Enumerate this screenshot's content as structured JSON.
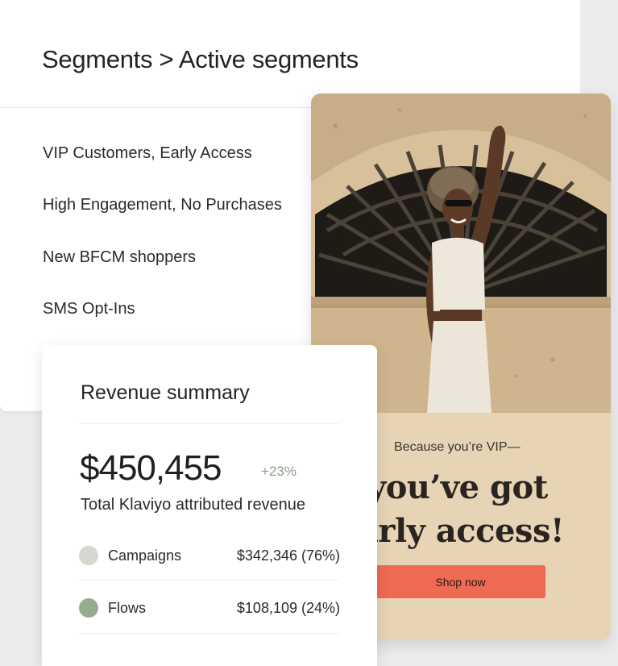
{
  "segments": {
    "breadcrumb": "Segments > Active segments",
    "items": [
      {
        "label": "VIP Customers, Early Access"
      },
      {
        "label": "High Engagement, No Purchases"
      },
      {
        "label": "New BFCM shoppers"
      },
      {
        "label": "SMS Opt-Ins"
      }
    ]
  },
  "email": {
    "kicker": "Because you’re VIP—",
    "headline_line1": "you’ve got",
    "headline_line2": "arly access!",
    "button_label": "Shop now",
    "colors": {
      "background": "#e6d4b5",
      "button": "#ee6a52"
    }
  },
  "revenue": {
    "title": "Revenue summary",
    "amount": "$450,455",
    "change": "+23%",
    "subtitle": "Total Klaviyo attributed revenue",
    "rows": [
      {
        "label": "Campaigns",
        "value": "$342,346 (76%)",
        "color": "#d6d8cf"
      },
      {
        "label": "Flows",
        "value": "$108,109 (24%)",
        "color": "#97ac8e"
      }
    ]
  }
}
